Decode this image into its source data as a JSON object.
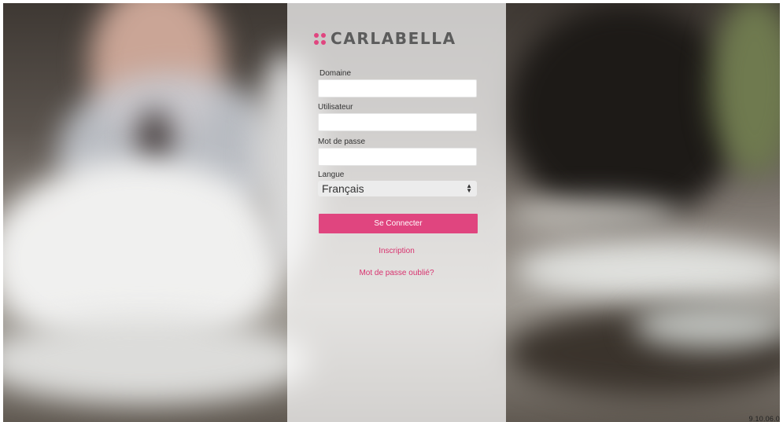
{
  "brand": {
    "name": "CARLABELLA",
    "accent_color": "#e0457f"
  },
  "form": {
    "domain_label": "Domaine",
    "domain_value": "",
    "user_label": "Utilisateur",
    "user_value": "",
    "password_label": "Mot de passe",
    "password_value": "",
    "language_label": "Langue",
    "language_selected": "Français",
    "submit_label": "Se Connecter"
  },
  "links": {
    "signup": "Inscription",
    "forgot_password": "Mot de passe oublié?"
  },
  "footer": {
    "version": "9.10.06.0"
  },
  "icons": {
    "logo": "dots-grid-icon",
    "select_arrows": "updown-arrows-icon"
  }
}
